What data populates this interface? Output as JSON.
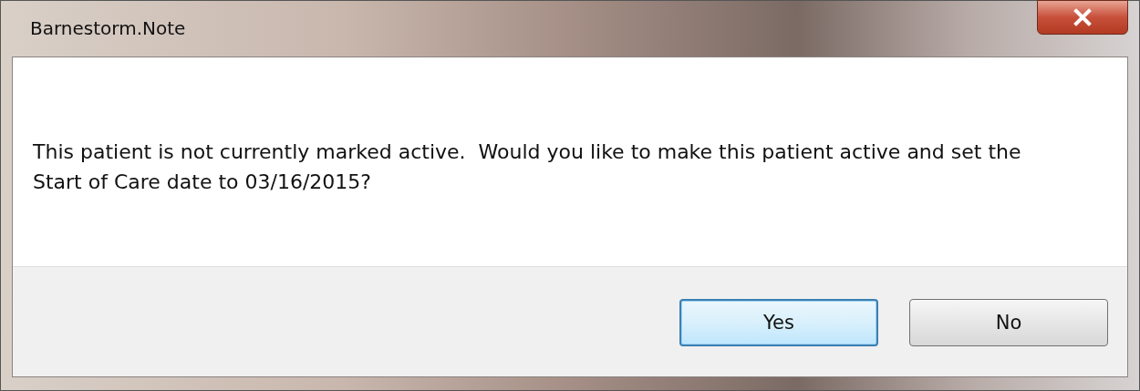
{
  "window": {
    "title": "Barnestorm.Note"
  },
  "message": "This patient is not currently marked active.  Would you like to make this patient active and set the Start of Care date to 03/16/2015?",
  "buttons": [
    {
      "label": "Yes",
      "selected": true
    },
    {
      "label": "No",
      "selected": false
    }
  ]
}
